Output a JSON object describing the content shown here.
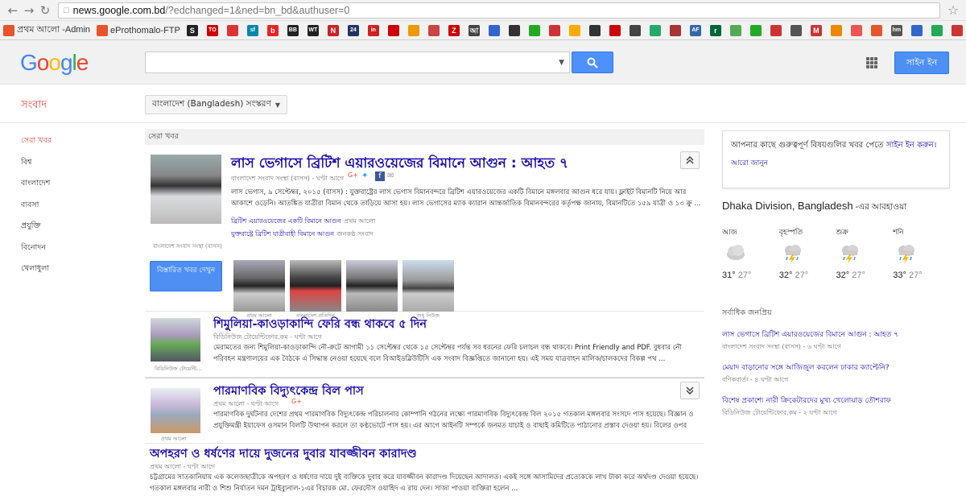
{
  "browser": {
    "url_domain": "news.google.com.bd",
    "url_rest": "/?edchanged=1&ned=bn_bd&authuser=0",
    "bookmarks": [
      {
        "label": "প্রথম আলো -Admin",
        "icon": "orange-dot-icon",
        "color": "#e8552b"
      },
      {
        "label": "eProthomalo-FTP",
        "icon": "orange-dot-icon",
        "color": "#e8552b"
      },
      {
        "label": "",
        "icon": "S",
        "color": "#222"
      },
      {
        "label": "",
        "icon": "TOI",
        "color": "#c00"
      },
      {
        "label": "",
        "icon": "",
        "color": "#d33"
      },
      {
        "label": "",
        "icon": "sf",
        "color": "#08a"
      },
      {
        "label": "",
        "icon": "b",
        "color": "#e22"
      },
      {
        "label": "",
        "icon": "BBC",
        "color": "#222"
      },
      {
        "label": "",
        "icon": "WT",
        "color": "#222"
      },
      {
        "label": "",
        "icon": "N",
        "color": "#c22"
      },
      {
        "label": "",
        "icon": "24",
        "color": "#236"
      },
      {
        "label": "",
        "icon": "in",
        "color": "#c22"
      },
      {
        "label": "",
        "icon": "",
        "color": "#c00"
      },
      {
        "label": "",
        "icon": "",
        "color": "#e90"
      },
      {
        "label": "",
        "icon": "",
        "color": "#c44"
      },
      {
        "label": "",
        "icon": "Z",
        "color": "#c00"
      },
      {
        "label": "",
        "icon": "আ",
        "color": "#444"
      },
      {
        "label": "",
        "icon": "",
        "color": "#36c"
      },
      {
        "label": "",
        "icon": "",
        "color": "#333"
      },
      {
        "label": "",
        "icon": "",
        "color": "#2a2"
      },
      {
        "label": "",
        "icon": "",
        "color": "#c33"
      },
      {
        "label": "",
        "icon": "",
        "color": "#fa0"
      },
      {
        "label": "",
        "icon": "",
        "color": "#333"
      },
      {
        "label": "",
        "icon": "",
        "color": "#c00"
      },
      {
        "label": "",
        "icon": "",
        "color": "#444"
      },
      {
        "label": "",
        "icon": "",
        "color": "#2a6"
      },
      {
        "label": "",
        "icon": "",
        "color": "#a33"
      },
      {
        "label": "",
        "icon": "AFP",
        "color": "#36a"
      },
      {
        "label": "",
        "icon": "r",
        "color": "#063"
      },
      {
        "label": "",
        "icon": "",
        "color": "#5a5"
      },
      {
        "label": "",
        "icon": "",
        "color": "#2a2"
      },
      {
        "label": "",
        "icon": "",
        "color": "#c33"
      },
      {
        "label": "",
        "icon": "",
        "color": "#555"
      },
      {
        "label": "",
        "icon": "M",
        "color": "#c33"
      },
      {
        "label": "",
        "icon": "",
        "color": "#e80"
      },
      {
        "label": "",
        "icon": "",
        "color": "#e55"
      },
      {
        "label": "",
        "icon": "",
        "color": "#e8552b"
      },
      {
        "label": "",
        "icon": "hm",
        "color": "#555"
      },
      {
        "label": "",
        "icon": "",
        "color": "#36c"
      },
      {
        "label": "",
        "icon": "",
        "color": "#2a5"
      },
      {
        "label": "",
        "icon": "",
        "color": "#c33"
      },
      {
        "label": "",
        "icon": "G",
        "color": "#36c"
      },
      {
        "label": "",
        "icon": "",
        "color": "#c33"
      }
    ]
  },
  "header": {
    "logo": "Google",
    "search_placeholder": "",
    "signin_label": "সাইন ইন"
  },
  "subheader": {
    "section_title": "সংবাদ",
    "edition_label": "বাংলাদেশ (Bangladesh) সংস্করণ"
  },
  "sidebar": {
    "items": [
      "সেরা খবর",
      "বিশ্ব",
      "বাংলাদেশ",
      "ব্যবসা",
      "প্রযুক্তি",
      "বিনোদন",
      "খেলাধুলা"
    ]
  },
  "main": {
    "top_label": "সেরা খবর",
    "story1": {
      "headline": "লাস ভেগাসে ব্রিটিশ এয়ারওয়েজের বিমানে আগুন : আহত ৭",
      "source": "বাংলাদেশ সংবাদ সংস্থা (বাসস) - ঘণ্টা আগে",
      "snippet": "লাস ভেগাস, ৯ সেপ্টেম্বর, ২০১৫ (বাসস) : যুক্তরাষ্ট্রের লাস ভেগাস বিমানবন্দরে ব্রিটিশ এয়ারওয়েজের একটি বিমানে মঙ্গলবার আগুন ধরে যায়। ফ্লাইট বিমানটি নিয়ে আর আকাশে ওড়েনি। আতঙ্কিত যাত্রীরা বিমান থেকে তাড়িয়ে আসা হয়। লাস ভেগাসের ম্যাক ক্যারান আন্তর্জাতিক বিমানবন্দরের কর্তৃপক্ষ জানায়, বিমানটিতে ১৫৯ যাত্রী ও ১৩ ক্রু ...",
      "related1": "ব্রিটিশ এয়ারওয়েজের একটি বিমানে আগুন",
      "related1_src": "প্রথম আলো",
      "related2": "যুক্তরাষ্ট্রে ব্রিটিশ যাত্রীবাহী বিমানে আগুন",
      "related2_src": "জনকণ্ঠ সংবাদ",
      "thumb_caption": "বাংলাদেশ সংবাদ সংস্থা (বাসস)",
      "more_button": "বিস্তারিত খবর দেখুন",
      "gallery_captions": [
        "প্রথম আলো",
        "বাংলাদেশ প্রতিদিন",
        "",
        "শুধু নিউজ"
      ]
    },
    "story2": {
      "headline": "শিমুলিয়া-কাওড়াকান্দি ফেরি বন্ধ থাকবে ৫ দিন",
      "source": "বিডিনিউজ টোয়েন্টিফোর.কম - ঘণ্টা আগে",
      "snippet": "মেরামতের জন্য শিমুলিয়া-কাওড়াকান্দি নৌ-রুটে আগামী ১১ সেপ্টেম্বর থেকে ১৫ সেপ্টেম্বর পর্যন্ত সব ধরনের ফেরি চলাচল বন্ধ থাকবে। Print Friendly and PDF. বুধবার নৌ পরিবহন মন্ত্রণালয়ের এক বৈঠকে এ সিদ্ধান্ত নেওয়া হয়েছে বলে বিআইডব্লিউটিসি এক সংবাদ বিজ্ঞপ্তিতে জানানো হয়। এই সময় যাত্রবাহন মালিক/চালকদের বিকল্প পথ ...",
      "thumb_caption": "বিডিনিউজ টোয়েন্টি..."
    },
    "story3": {
      "headline": "পারমাণবিক বিদ্যুৎকেন্দ্র বিল পাস",
      "source": "প্রথম আলো - ঘণ্টা আগে",
      "snippet": "পারমাণবিক দুর্ঘটনার দেশের প্রথম পারমাণবিক বিদ্যুৎকেন্দ্র পরিচালনার কোম্পানি গঠনের লক্ষ্যে পারমাণবিক বিদ্যুৎকেন্দ্র বিল ২০১৫ গতকাল মঙ্গলবার সংসদে পাস হয়েছে। বিজ্ঞান ও প্রযুক্তিমন্ত্রী ইয়াফেস ওসমান বিলটি উত্থাপন করলে তা কণ্ঠভোটে পাস হয়। এর আগে আইনটি সম্পর্কে জনমত যাচাই ও বাছাই কমিটিতে পাঠানোর প্রস্তাব দেওয়া হয়। বিলের ওপর দেওয়া বিরোধীদলীয় সদস্যদের ...",
      "thumb_caption": "প্রথম আলো"
    },
    "story4": {
      "headline": "অপহরণ ও ধর্ষণের দায়ে দুজনের দুবার যাবজ্জীবন কারাদণ্ড",
      "source": "প্রথম আলো - ঘণ্টা আগে",
      "snippet1": "চট্টগ্রামের সাতকানিয়ায় এক কলেজছাত্রীকে অপহরণ ও ধর্ষণের দায়ে দুই ব্যক্তিকে দুবার করে যাবজ্জীবন কারাদণ্ড দিয়েছেন আদালত। একই সঙ্গে আসামিদের প্রত্যেককে লাখ টাকা করে অর্থদণ্ড দেওয়া হয়েছে।",
      "snippet2": "গতকাল মঙ্গলবার নারী ও শিশু নির্যাতন দমন ট্রাইব্যুনাল-১এর বিচারক মো. ফেরদৌস ওয়াহিদ এ রায় দেন। সাজা পাওয়া ব্যক্তিরা হলেন ..."
    }
  },
  "right": {
    "promo_text": "আপনার কাছে গুরুত্বপূর্ণ বিষয়গুলির খবর পেতে ",
    "promo_link": "সাইন ইন করুন।",
    "promo_more": "আরো জানুন",
    "weather_location": "Dhaka Division, Bangladesh",
    "weather_suffix": " -এর আবহাওয়া",
    "weather": [
      {
        "day": "আজ",
        "hi": "31°",
        "lo": "27°",
        "icon": "cloudy-icon"
      },
      {
        "day": "বৃহস্পতি",
        "hi": "32°",
        "lo": "27°",
        "icon": "thunderstorm-icon"
      },
      {
        "day": "শুক্র",
        "hi": "32°",
        "lo": "27°",
        "icon": "thunderstorm-icon"
      },
      {
        "day": "শনি",
        "hi": "33°",
        "lo": "27°",
        "icon": "thunderstorm-icon"
      }
    ],
    "popular_title": "সর্বাধিক জনপ্রিয়",
    "popular": [
      {
        "title": "লাস ভেগাসে ব্রিটিশ এয়ারওয়েজের বিমানে আগুন : আহত ৭",
        "src": "বাংলাদেশ সংবাদ সংস্থা (বাসস) - ৬ ঘণ্টা আগে"
      },
      {
        "title": "মেয়াদ বাড়ানোর সঙ্গে আজিজুল করলেন ঢাকার ক্যাপ্টেনি?",
        "src": "বণিকবার্তা - ৪ ঘণ্টা আগে"
      },
      {
        "title": "বিশেষ প্রকাশ্যে নারী ক্রিকেটারদের মুখ্য খেলোয়াড় তৌশরাফ",
        "src": "বিডিনিউজ টোয়েন্টিফোর.কম - ২ ঘণ্টা আগে"
      }
    ]
  }
}
